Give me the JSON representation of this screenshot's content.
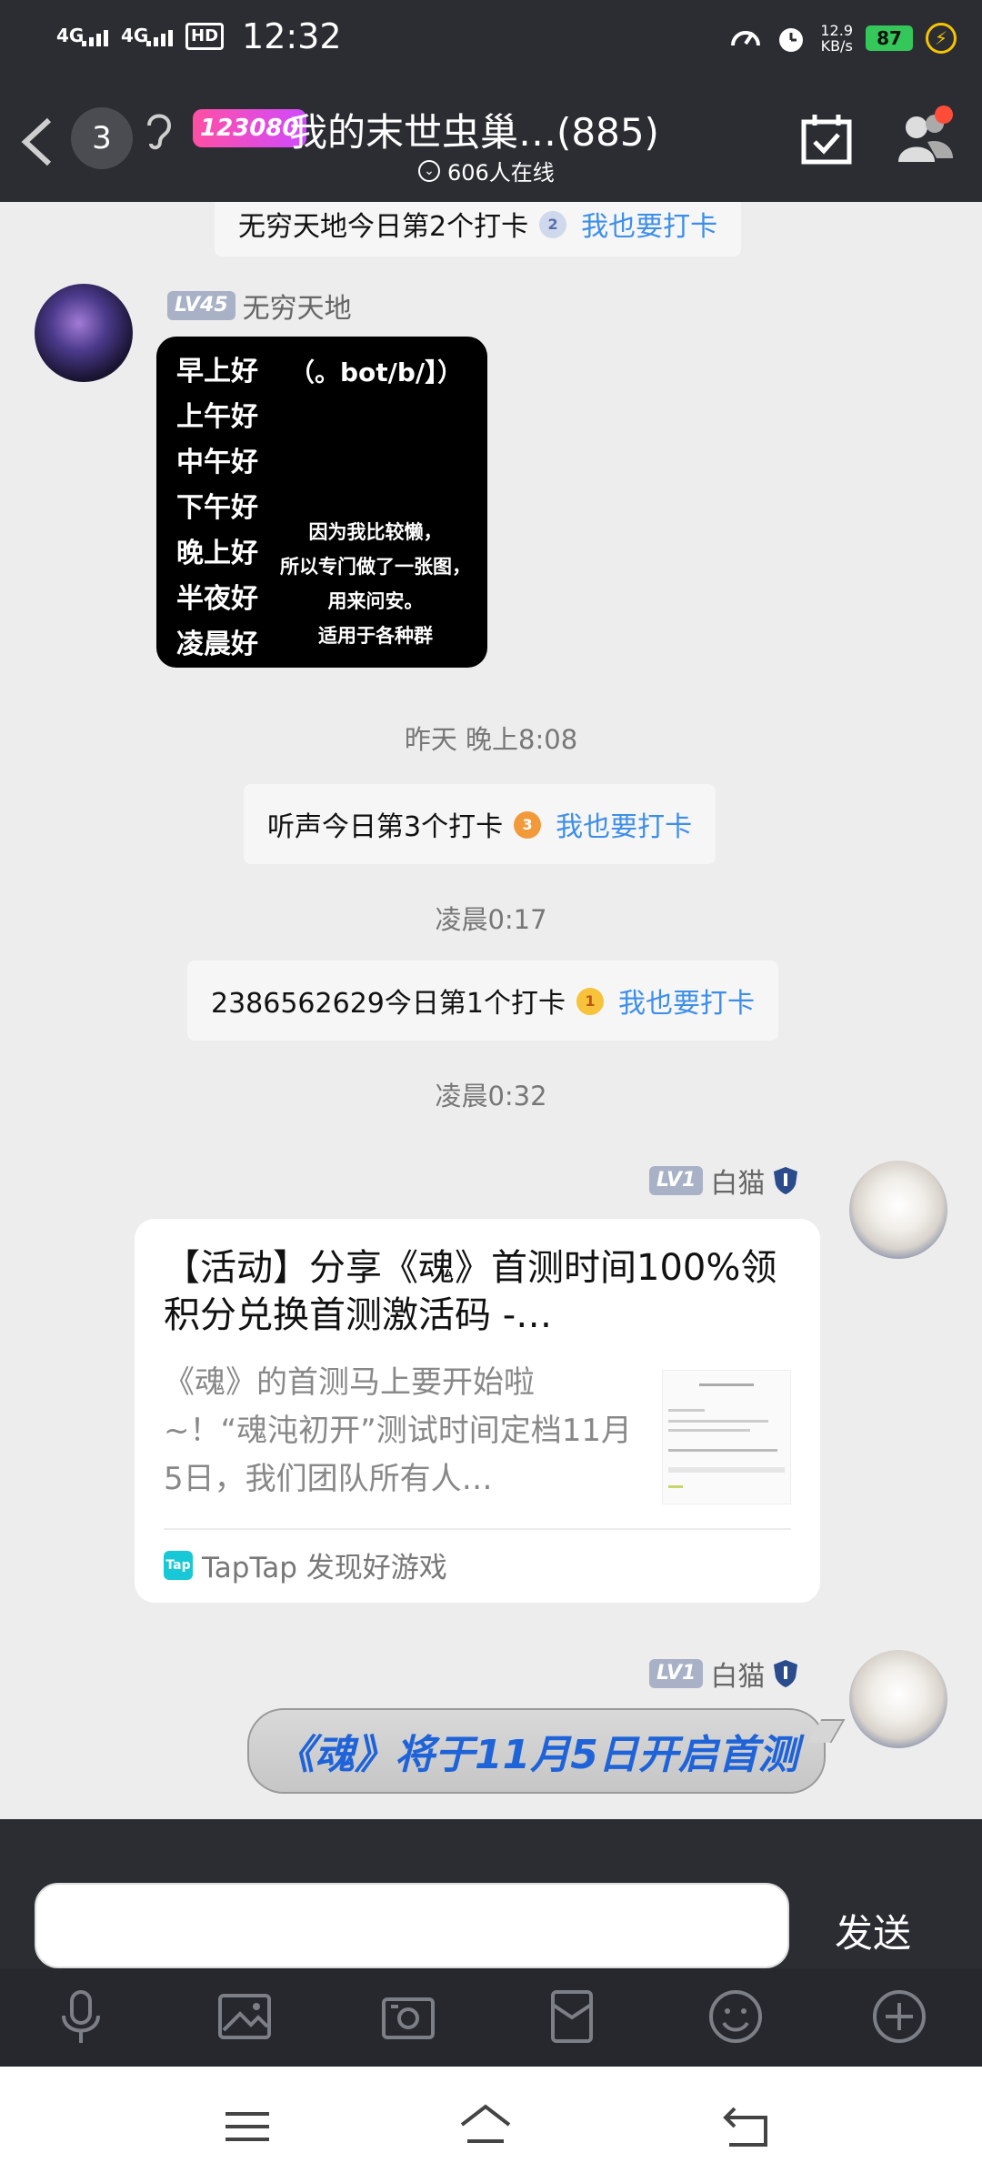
{
  "status_bar": {
    "signal1": "4G",
    "signal2": "4G",
    "hd": "HD",
    "time": "12:32",
    "net_speed_value": "12.9",
    "net_speed_unit": "KB/s",
    "battery": "87"
  },
  "header": {
    "unread_count": "3",
    "group_badge": "123080",
    "title": "我的末世虫巢…(885)",
    "online": "606人在线"
  },
  "messages": {
    "sys_top": {
      "text": "无穷天地今日第2个打卡",
      "medal": "2",
      "link": "我也要打卡"
    },
    "msg1": {
      "level": "LV45",
      "nickname": "无穷天地",
      "image": {
        "header": "（。bot/b/】）",
        "greetings": [
          "早上好",
          "上午好",
          "中午好",
          "下午好",
          "晚上好",
          "半夜好",
          "凌晨好"
        ],
        "note": [
          "因为我比较懒，",
          "所以专门做了一张图，",
          "用来问安。",
          "适用于各种群"
        ]
      }
    },
    "time1": "昨天 晚上8:08",
    "sys2": {
      "text": "听声今日第3个打卡",
      "medal": "3",
      "link": "我也要打卡"
    },
    "time2": "凌晨0:17",
    "sys3": {
      "text": "2386562629今日第1个打卡",
      "medal": "1",
      "link": "我也要打卡"
    },
    "time3": "凌晨0:32",
    "msg2": {
      "level": "LV1",
      "nickname": "白猫",
      "card": {
        "title": "【活动】分享《魂》首测时间100%领积分兑换首测激活码 -…",
        "desc": "《魂》的首测马上要开始啦~！“魂沌初开”测试时间定档11月5日，我们团队所有人…",
        "source_logo": "Tap",
        "source": "TapTap 发现好游戏"
      }
    },
    "msg3": {
      "level": "LV1",
      "nickname": "白猫",
      "text": "《魂》将于11月5日开启首测"
    }
  },
  "input": {
    "value": "",
    "send_label": "发送"
  },
  "colors": {
    "bar_bg": "#2b2d33",
    "chat_bg": "#ededed",
    "link": "#3d8eea",
    "bubble_text": "#1f63d8",
    "battery": "#34c759"
  },
  "icons": {
    "toolbar": [
      "microphone-icon",
      "image-icon",
      "camera-icon",
      "red-packet-icon",
      "emoji-icon",
      "plus-icon"
    ],
    "nav": [
      "menu-icon",
      "home-icon",
      "back-icon"
    ]
  }
}
